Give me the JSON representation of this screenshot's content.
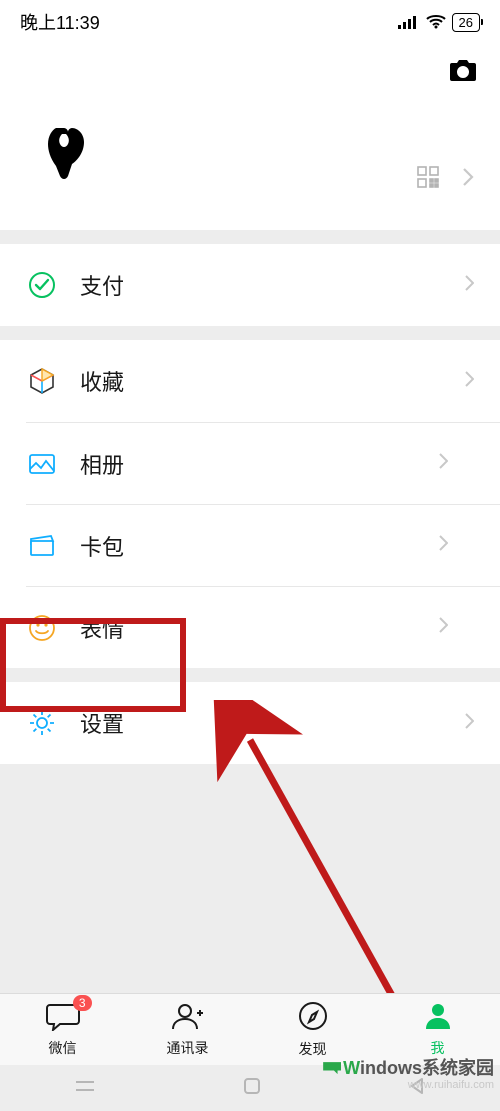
{
  "status": {
    "time": "晚上11:39",
    "battery": "26"
  },
  "menu": {
    "pay": {
      "label": "支付"
    },
    "fav": {
      "label": "收藏"
    },
    "album": {
      "label": "相册"
    },
    "cards": {
      "label": "卡包"
    },
    "stickers": {
      "label": "表情"
    },
    "settings": {
      "label": "设置"
    }
  },
  "nav": {
    "chat": {
      "label": "微信",
      "badge": "3"
    },
    "contacts": {
      "label": "通讯录"
    },
    "discover": {
      "label": "发现"
    },
    "me": {
      "label": "我"
    }
  },
  "watermark": {
    "brand_head": "W",
    "brand_rest": "indows系统家园",
    "url": "www.ruihaifu.com"
  },
  "colors": {
    "accent": "#07c160",
    "badge": "#fa5151",
    "highlight": "#bf1a1a"
  }
}
